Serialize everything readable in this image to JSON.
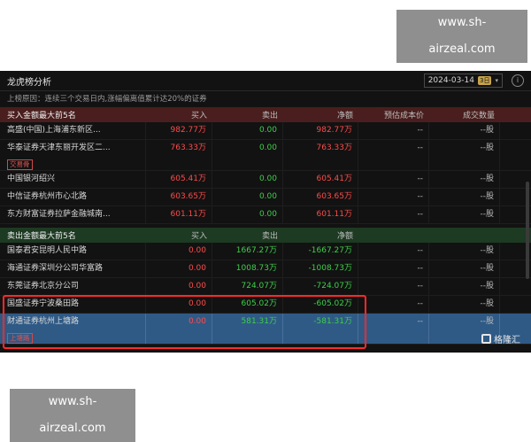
{
  "watermarks": {
    "top": "www.sh-airzeal.com",
    "bottom": "www.sh-airzeal.com"
  },
  "header": {
    "title": "龙虎榜分析",
    "date": "2024-03-14",
    "date_badge": "3日",
    "caret": "▾",
    "info": "i"
  },
  "reason": "上榜原因：连续三个交易日内,涨幅偏离值累计达20%的证券",
  "buy": {
    "columns": [
      "买入金额最大前5名",
      "买入",
      "卖出",
      "净额",
      "预估成本价",
      "成交数量"
    ],
    "rows": [
      {
        "name": "高盛(中国)上海浦东新区...",
        "buy": "982.77万",
        "sell": "0.00",
        "net": "982.77万",
        "cost": "--",
        "qty": "--股"
      },
      {
        "name": "华泰证券天津东丽开发区二...",
        "buy": "763.33万",
        "sell": "0.00",
        "net": "763.33万",
        "cost": "--",
        "qty": "--股",
        "tag": "交易骨"
      },
      {
        "name": "中国银河绍兴",
        "buy": "605.41万",
        "sell": "0.00",
        "net": "605.41万",
        "cost": "--",
        "qty": "--股"
      },
      {
        "name": "中信证券杭州市心北路",
        "buy": "603.65万",
        "sell": "0.00",
        "net": "603.65万",
        "cost": "--",
        "qty": "--股"
      },
      {
        "name": "东方财富证券拉萨金融城南...",
        "buy": "601.11万",
        "sell": "0.00",
        "net": "601.11万",
        "cost": "--",
        "qty": "--股"
      }
    ]
  },
  "sell": {
    "columns": [
      "卖出金额最大前5名",
      "买入",
      "卖出",
      "净额",
      "",
      ""
    ],
    "rows": [
      {
        "name": "国泰君安昆明人民中路",
        "buy": "0.00",
        "sell": "1667.27万",
        "net": "-1667.27万",
        "cost": "--",
        "qty": "--股"
      },
      {
        "name": "海通证券深圳分公司华富路",
        "buy": "0.00",
        "sell": "1008.73万",
        "net": "-1008.73万",
        "cost": "--",
        "qty": "--股"
      },
      {
        "name": "东莞证券北京分公司",
        "buy": "0.00",
        "sell": "724.07万",
        "net": "-724.07万",
        "cost": "--",
        "qty": "--股"
      },
      {
        "name": "国盛证券宁波桑田路",
        "buy": "0.00",
        "sell": "605.02万",
        "net": "-605.02万",
        "cost": "--",
        "qty": "--股"
      },
      {
        "name": "财通证券杭州上塘路",
        "buy": "0.00",
        "sell": "581.31万",
        "net": "-581.31万",
        "cost": "--",
        "qty": "--股",
        "tag": "上塘路",
        "selected": true
      }
    ]
  },
  "logo": "格隆汇",
  "colors": {
    "buy_header": "#4a1e1e",
    "sell_header": "#1d3a22",
    "positive": "#ff4a4a",
    "negative": "#3ecf4a",
    "selected": "#2f5a86",
    "highlight": "#ff2a2a"
  }
}
